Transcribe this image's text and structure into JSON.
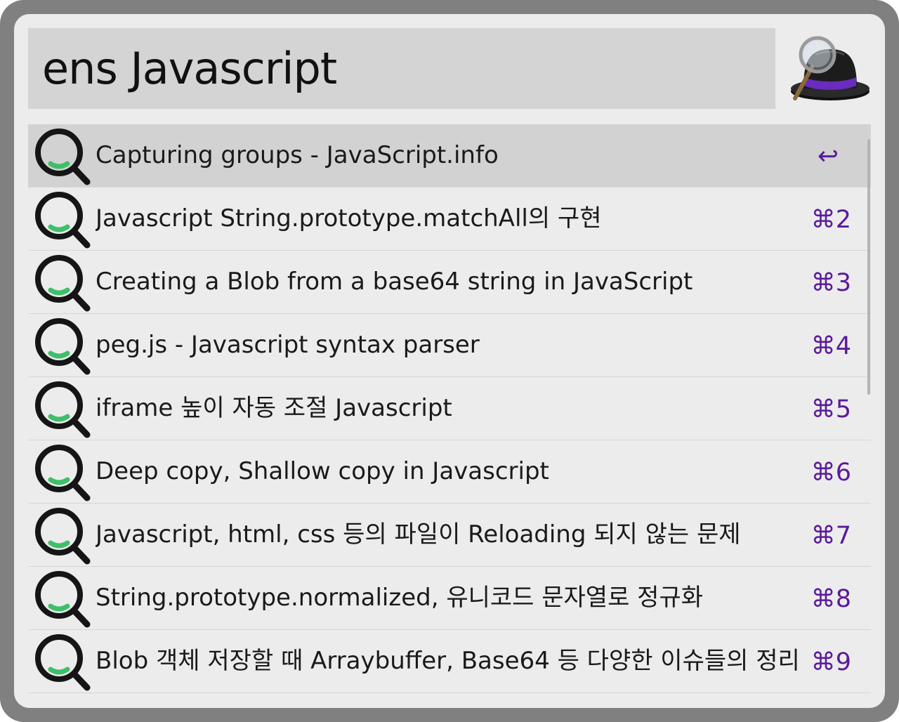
{
  "search": {
    "query": "ens Javascript"
  },
  "app": {
    "logo_icon": "alfred-hat-magnifier-icon",
    "accent_color": "#5a1a9a"
  },
  "results": [
    {
      "title": "Capturing groups - JavaScript.info",
      "shortcut": "↩",
      "selected": true,
      "icon": "search-magnifier-icon"
    },
    {
      "title": "Javascript String.prototype.matchAll의 구현",
      "shortcut": "⌘2",
      "icon": "search-magnifier-icon"
    },
    {
      "title": "Creating a Blob from a base64 string in JavaScript",
      "shortcut": "⌘3",
      "icon": "search-magnifier-icon"
    },
    {
      "title": "peg.js - Javascript syntax parser",
      "shortcut": "⌘4",
      "icon": "search-magnifier-icon"
    },
    {
      "title": "iframe 높이 자동 조절 Javascript",
      "shortcut": "⌘5",
      "icon": "search-magnifier-icon"
    },
    {
      "title": "Deep copy, Shallow copy in Javascript",
      "shortcut": "⌘6",
      "icon": "search-magnifier-icon"
    },
    {
      "title": "Javascript, html, css 등의 파일이 Reloading 되지 않는 문제",
      "shortcut": "⌘7",
      "icon": "search-magnifier-icon"
    },
    {
      "title": "String.prototype.normalized, 유니코드 문자열로 정규화",
      "shortcut": "⌘8",
      "icon": "search-magnifier-icon"
    },
    {
      "title": "Blob 객체 저장할  때 Arraybuffer, Base64 등 다양한 이슈들의 정리",
      "shortcut": "⌘9",
      "icon": "search-magnifier-icon"
    }
  ]
}
